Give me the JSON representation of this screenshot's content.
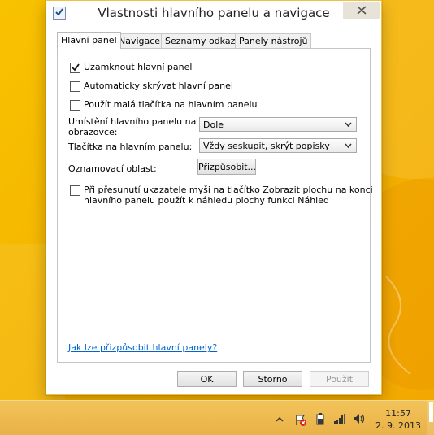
{
  "window": {
    "title": "Vlastnosti hlavního panelu a navigace"
  },
  "tabs": [
    {
      "label": "Hlavní panel"
    },
    {
      "label": "Navigace"
    },
    {
      "label": "Seznamy odkazů"
    },
    {
      "label": "Panely nástrojů"
    }
  ],
  "checkboxes": {
    "lock": {
      "label": "Uzamknout hlavní panel",
      "checked": true
    },
    "autohide": {
      "label": "Automaticky skrývat hlavní panel",
      "checked": false
    },
    "small_buttons": {
      "label": "Použít malá tlačítka na hlavním panelu",
      "checked": false
    },
    "peek": {
      "label_line1": "Při přesunutí ukazatele myši na tlačítko Zobrazit plochu na konci",
      "label_line2": "hlavního panelu použít k náhledu plochy funkci Náhled",
      "checked": false
    }
  },
  "fields": {
    "location_label_line1": "Umístění hlavního panelu na",
    "location_label_line2": "obrazovce:",
    "location_value": "Dole",
    "buttons_label": "Tlačítka na hlavním panelu:",
    "buttons_value": "Vždy seskupit, skrýt popisky",
    "notify_label": "Oznamovací oblast:",
    "customize_label": "Přizpůsobit..."
  },
  "help_link": "Jak lze přizpůsobit hlavní panely?",
  "footer": {
    "ok": "OK",
    "cancel": "Storno",
    "apply": "Použít"
  },
  "taskbar": {
    "time": "11:57",
    "date": "2. 9. 2013",
    "tray_icons": [
      "chevron-up-icon",
      "action-center-flag-icon",
      "power-icon",
      "network-signal-icon",
      "volume-icon"
    ]
  },
  "colors": {
    "desktop": "#f5b800",
    "taskbar": "#eeba50",
    "link": "#0066cc"
  }
}
